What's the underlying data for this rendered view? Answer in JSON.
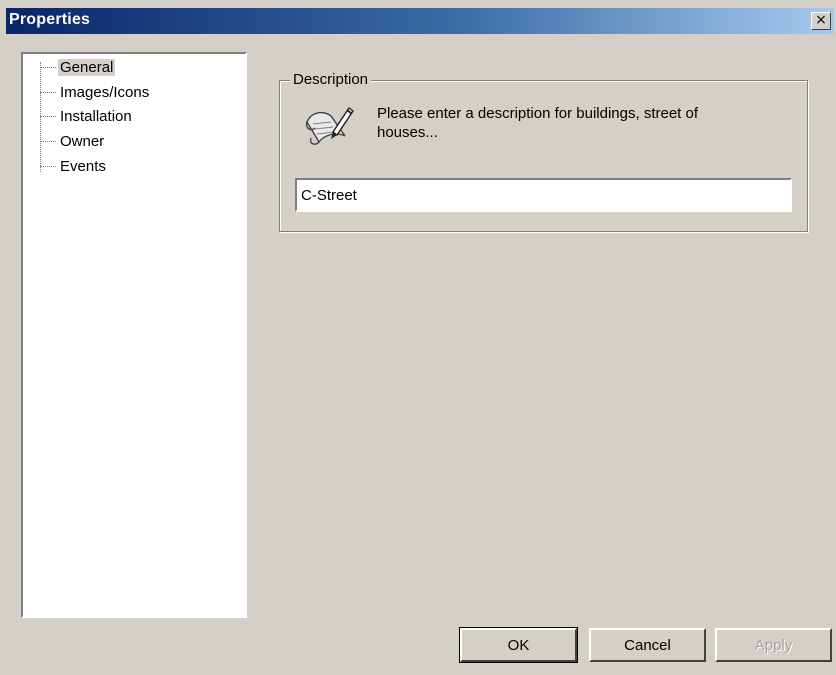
{
  "window": {
    "title": "Properties",
    "close_glyph": "×"
  },
  "tree": {
    "items": [
      {
        "label": "General",
        "selected": true
      },
      {
        "label": "Images/Icons",
        "selected": false
      },
      {
        "label": "Installation",
        "selected": false
      },
      {
        "label": "Owner",
        "selected": false
      },
      {
        "label": "Events",
        "selected": false
      }
    ]
  },
  "description": {
    "group_label": "Description",
    "hint": "Please enter a description for buildings, street of houses...",
    "value": "C-Street",
    "icon": "pen-scroll-icon"
  },
  "buttons": {
    "ok_label": "OK",
    "cancel_label": "Cancel",
    "apply_label": "Apply"
  }
}
